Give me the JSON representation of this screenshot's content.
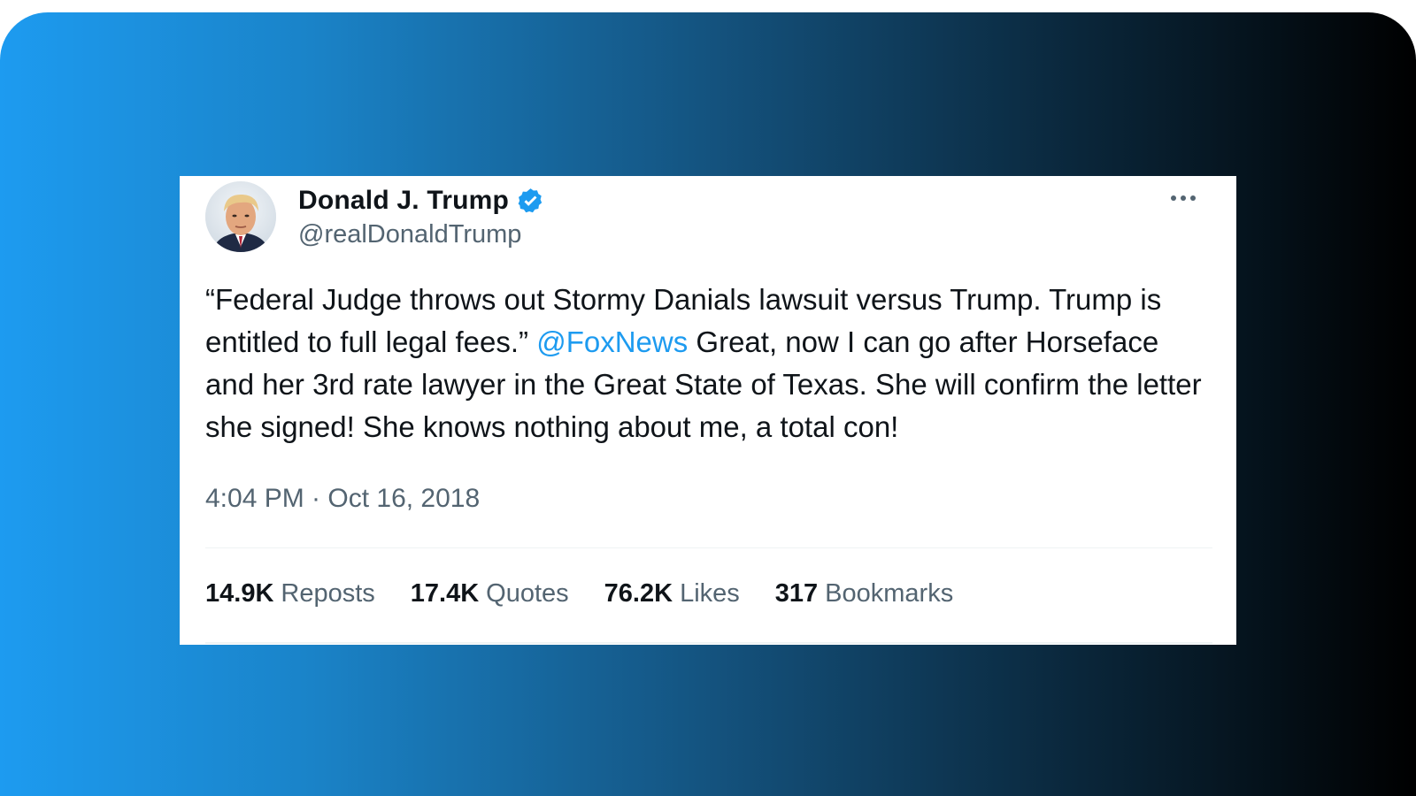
{
  "tweet": {
    "display_name": "Donald J. Trump",
    "handle": "@realDonaldTrump",
    "verified": true,
    "text_part1": "“Federal Judge throws out Stormy Danials lawsuit versus Trump. Trump is entitled to full legal fees.” ",
    "mention": "@FoxNews",
    "text_part2": " Great, now I can go after Horseface and her 3rd rate lawyer in the Great State of Texas. She will confirm the letter she signed! She knows nothing about me, a total con!",
    "timestamp": "4:04 PM · Oct 16, 2018",
    "stats": [
      {
        "count": "14.9K",
        "label": "Reposts"
      },
      {
        "count": "17.4K",
        "label": "Quotes"
      },
      {
        "count": "76.2K",
        "label": "Likes"
      },
      {
        "count": "317",
        "label": "Bookmarks"
      }
    ]
  },
  "colors": {
    "accent": "#1d9bf0",
    "text_primary": "#0f1419",
    "text_secondary": "#536471",
    "background_gradient_start": "#1d9bf0",
    "background_gradient_end": "#000000"
  },
  "icons": {
    "verified": "verified-badge-icon",
    "more": "more-options-icon",
    "avatar": "profile-avatar"
  }
}
